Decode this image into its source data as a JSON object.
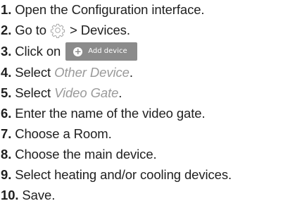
{
  "steps": [
    {
      "number": "1.",
      "text": "Open the Configuration interface."
    },
    {
      "number": "2.",
      "before": "Go to",
      "icon": "gear-icon",
      "after": "> Devices."
    },
    {
      "number": "3.",
      "before": "Click on",
      "button": {
        "icon": "plus-circle-icon",
        "plus_glyph": "+",
        "label": "Add device"
      }
    },
    {
      "number": "4.",
      "before": "Select",
      "emphasis": "Other Device",
      "after": "."
    },
    {
      "number": "5.",
      "before": "Select",
      "emphasis": "Video Gate",
      "after": "."
    },
    {
      "number": "6.",
      "text": "Enter the name of the video gate."
    },
    {
      "number": "7.",
      "text": "Choose a Room."
    },
    {
      "number": "8.",
      "text": "Choose the main device."
    },
    {
      "number": "9.",
      "text": "Select heating and/or cooling devices."
    },
    {
      "number": "10.",
      "text": "Save."
    }
  ],
  "colors": {
    "text": "#1f1f1f",
    "emphasis": "#9a9a9a",
    "button_bg": "#8b8b8b",
    "button_text": "#ffffff",
    "icon_stroke": "#a0a0a0"
  }
}
